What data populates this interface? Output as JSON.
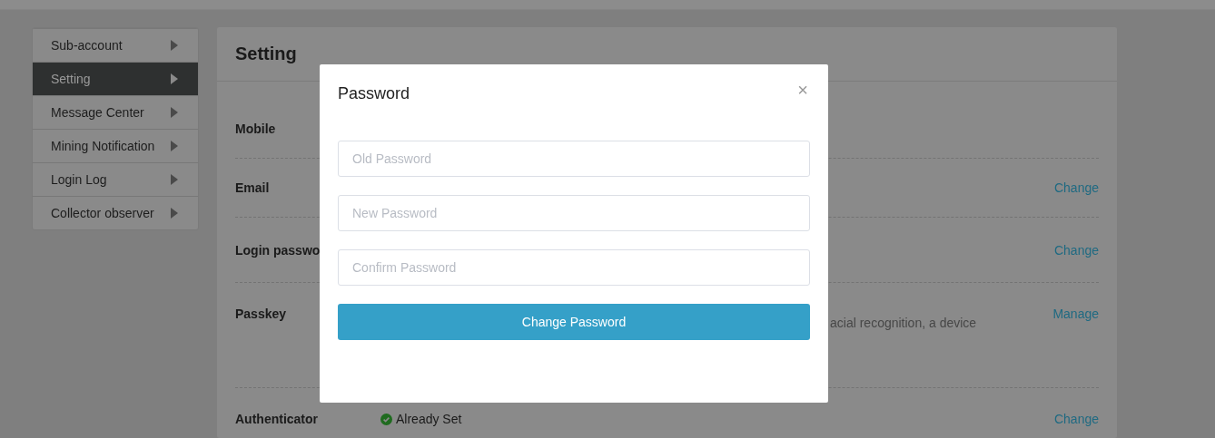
{
  "sidebar": {
    "items": [
      {
        "label": "Sub-account",
        "selected": false
      },
      {
        "label": "Setting",
        "selected": true
      },
      {
        "label": "Message Center",
        "selected": false
      },
      {
        "label": "Mining Notification",
        "selected": false
      },
      {
        "label": "Login Log",
        "selected": false
      },
      {
        "label": "Collector observer",
        "selected": false
      }
    ]
  },
  "panel": {
    "title": "Setting",
    "rows": [
      {
        "label": "Mobile"
      },
      {
        "label": "Email",
        "action": "Change"
      },
      {
        "label": "Login passwo",
        "action": "Change"
      },
      {
        "label": "Passkey",
        "action": "Manage",
        "description": "acial recognition, a device"
      },
      {
        "label": "Authenticator",
        "action": "Change",
        "status": {
          "text": "Already Set",
          "verified": true
        }
      }
    ]
  },
  "modal": {
    "title": "Password",
    "close": "×",
    "fields": [
      {
        "placeholder": "Old Password"
      },
      {
        "placeholder": "New Password"
      },
      {
        "placeholder": "Confirm Password"
      }
    ],
    "submit": "Change Password"
  }
}
